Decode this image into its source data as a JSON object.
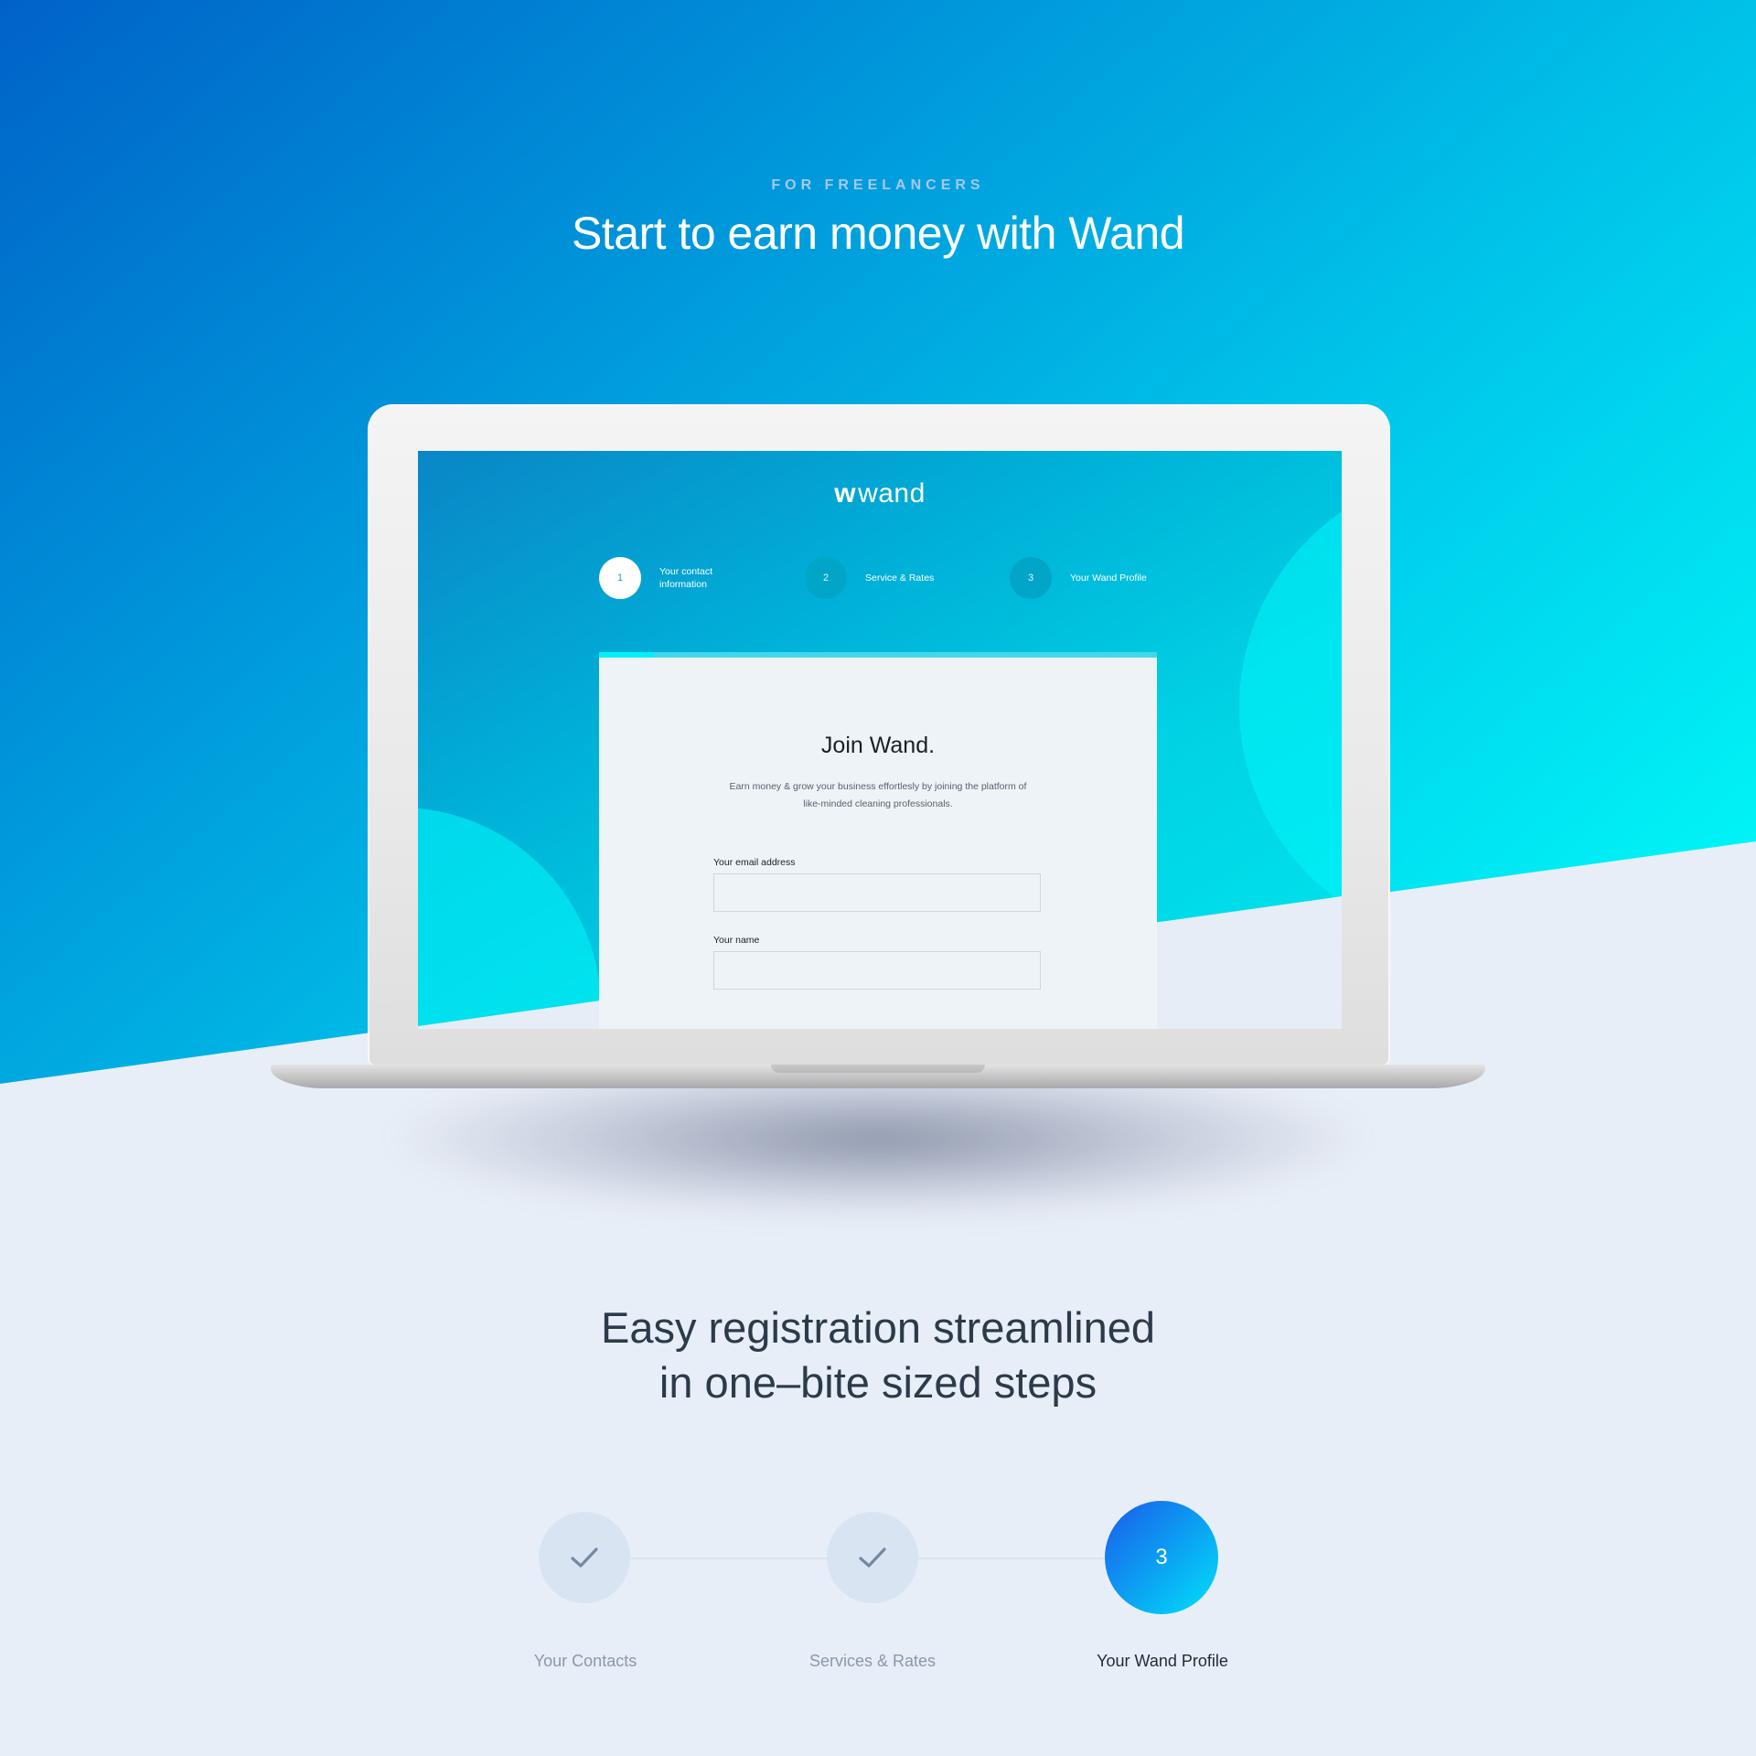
{
  "hero": {
    "eyebrow": "FOR FREELANCERS",
    "title": "Start to earn money with Wand"
  },
  "screen": {
    "logo_mark": "w",
    "logo_text": "wand",
    "steps": [
      {
        "number": "1",
        "label_line1": "Your contact",
        "label_line2": "information",
        "state": "active"
      },
      {
        "number": "2",
        "label": "Service & Rates",
        "state": "upcoming"
      },
      {
        "number": "3",
        "label": "Your Wand Profile",
        "state": "upcoming"
      }
    ],
    "card": {
      "title": "Join Wand.",
      "description_line1": "Earn money & grow your business effortlesly by joining the platform of",
      "description_line2": "like-minded cleaning professionals.",
      "email_label": "Your email address",
      "email_value": "",
      "name_label": "Your name",
      "name_value": ""
    }
  },
  "feature": {
    "title_line1": "Easy registration streamlined",
    "title_line2": "in one–bite sized steps",
    "steps": [
      {
        "label": "Your Contacts",
        "state": "done",
        "icon": "check-icon"
      },
      {
        "label": "Services & Rates",
        "state": "done",
        "icon": "check-icon"
      },
      {
        "label": "Your Wand Profile",
        "state": "current",
        "number": "3"
      }
    ]
  },
  "colors": {
    "hero_gradient_start": "#0062c8",
    "hero_gradient_end": "#00ffff",
    "page_background": "#e8eef7",
    "current_step_start": "#1a5bea",
    "current_step_end": "#00e1fb",
    "done_step": "#d9e4f3"
  }
}
